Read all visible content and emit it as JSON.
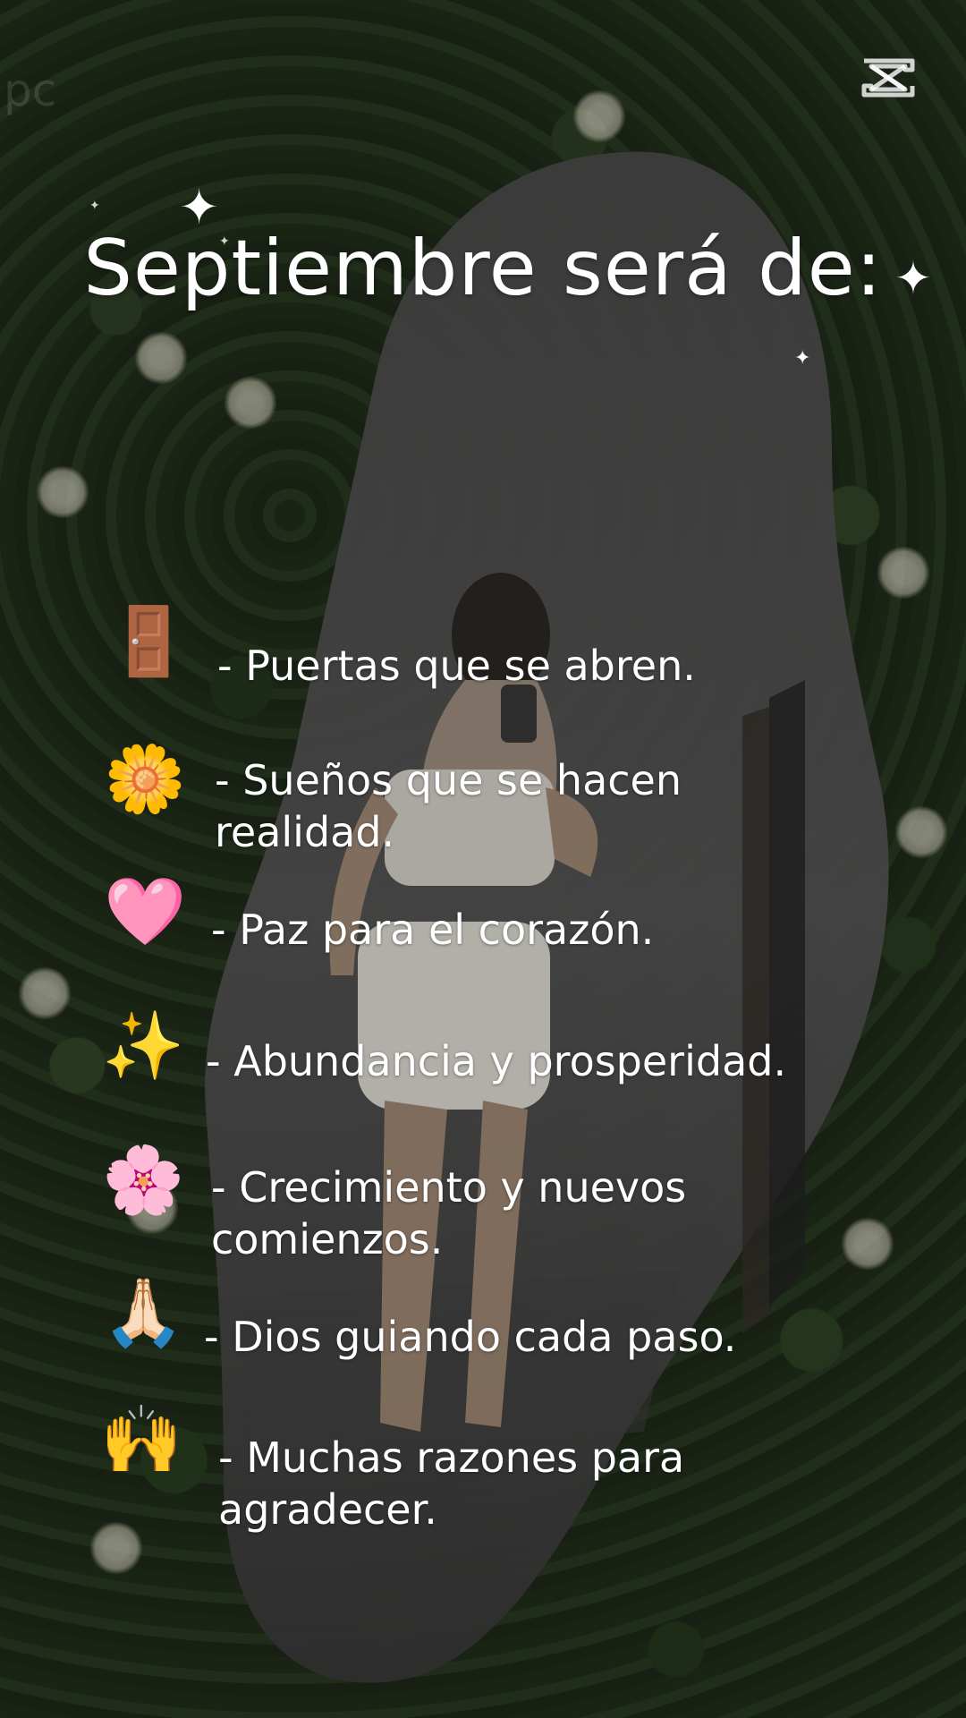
{
  "title": "Septiembre será de:",
  "watermark": "pc",
  "items": [
    {
      "icon": "door-icon",
      "glyph": "🚪",
      "text": "- Puertas que se abren."
    },
    {
      "icon": "sunflower-icon",
      "glyph": "🌼",
      "text": "- Sueños que se hacen realidad."
    },
    {
      "icon": "pink-heart-icon",
      "glyph": "🩷",
      "text": "- Paz para el corazón."
    },
    {
      "icon": "sparkles-icon",
      "glyph": "✨",
      "text": "- Abundancia y prosperidad."
    },
    {
      "icon": "cherry-blossom-icon",
      "glyph": "🌸",
      "text": "- Crecimiento y nuevos comienzos."
    },
    {
      "icon": "praying-hands-icon",
      "glyph": "🙏🏻",
      "text": "- Dios guiando cada paso."
    },
    {
      "icon": "raising-hands-icon",
      "glyph": "🙌",
      "text": "- Muchas razones para agradecer."
    }
  ],
  "colors": {
    "text": "#ffffff",
    "mirror": "#3a3a3a",
    "leaves": "#2f4526"
  }
}
